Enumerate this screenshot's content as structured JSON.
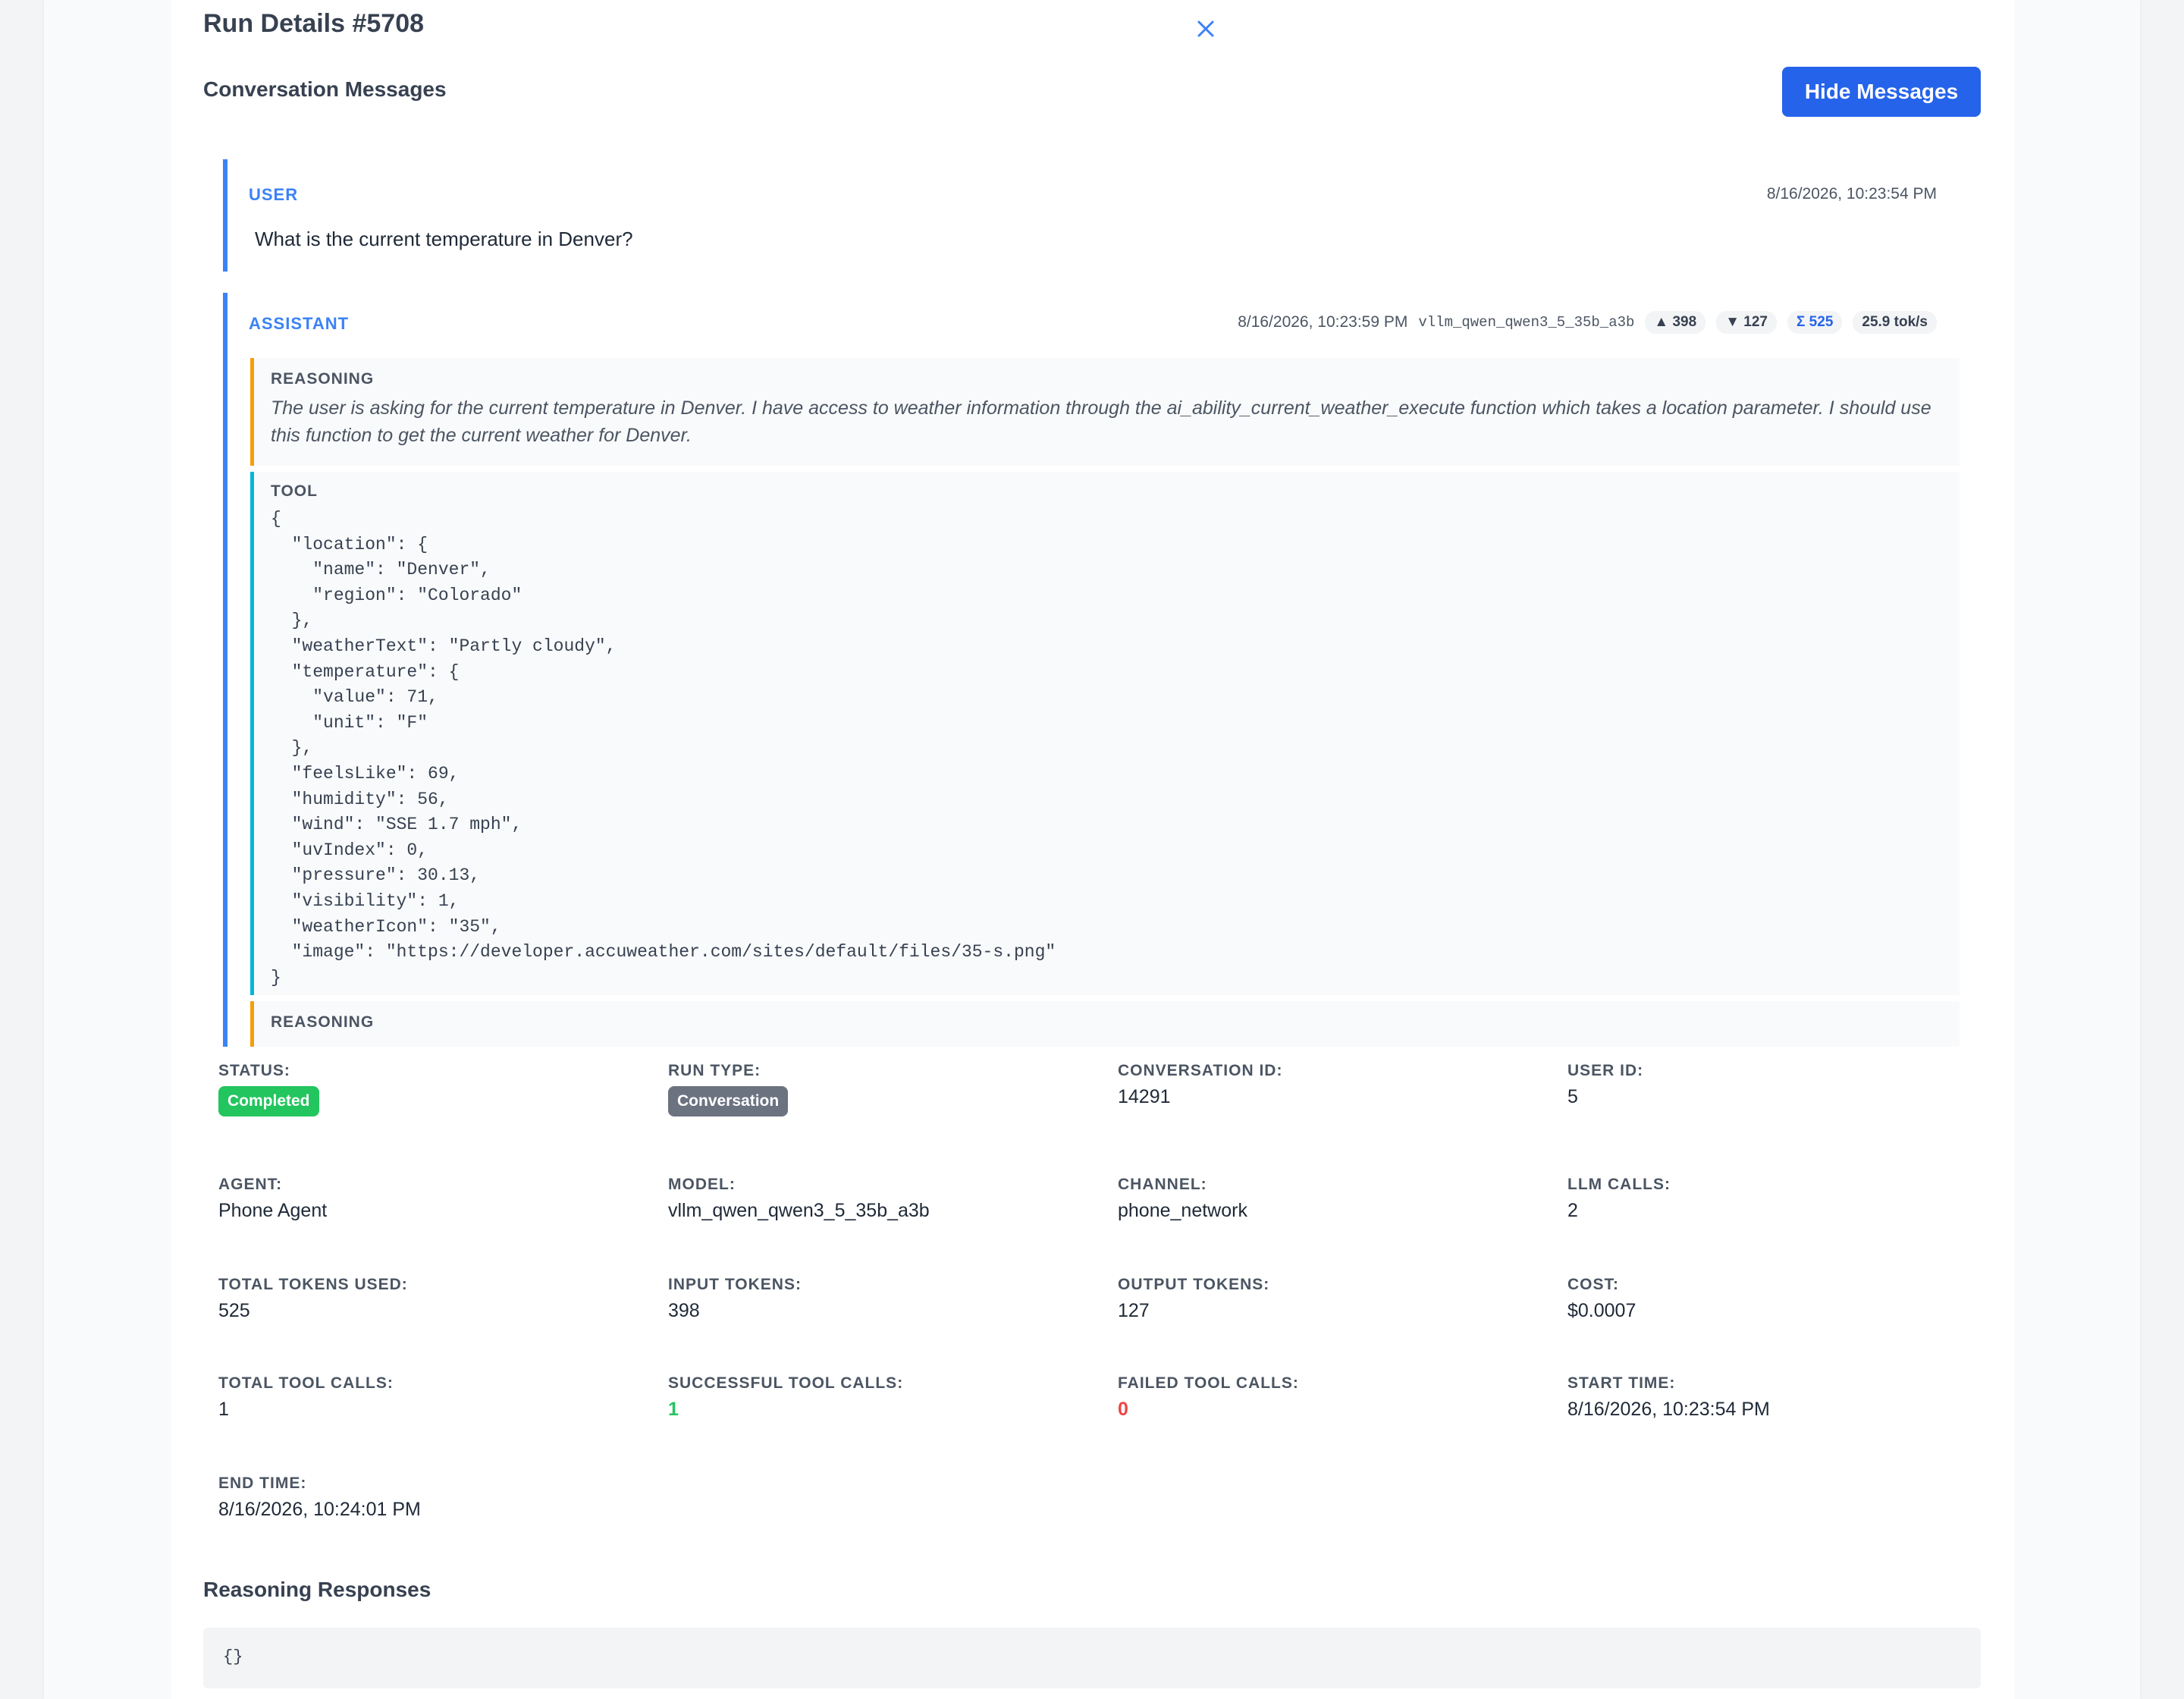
{
  "header": {
    "title": "Run Details #5708",
    "close_icon": "close-icon"
  },
  "messages_section": {
    "title": "Conversation Messages",
    "toggle_label": "Hide Messages",
    "user_message": {
      "role": "USER",
      "timestamp": "8/16/2026, 10:23:54 PM",
      "text": "What is the current temperature in Denver?"
    },
    "assistant_message": {
      "role": "ASSISTANT",
      "timestamp": "8/16/2026, 10:23:59 PM",
      "model": "vllm_qwen_qwen3_5_35b_a3b",
      "tokens_in": "▲ 398",
      "tokens_out": "▼ 127",
      "tokens_total": "Σ 525",
      "speed": "25.9 tok/s",
      "reasoning_label": "REASONING",
      "reasoning_text": "The user is asking for the current temperature in Denver. I have access to weather information through the ai_ability_current_weather_execute function which takes a location parameter. I should use this function to get the current weather for Denver.",
      "tool_label": "TOOL",
      "tool_output": "{\n  \"location\": {\n    \"name\": \"Denver\",\n    \"region\": \"Colorado\"\n  },\n  \"weatherText\": \"Partly cloudy\",\n  \"temperature\": {\n    \"value\": 71,\n    \"unit\": \"F\"\n  },\n  \"feelsLike\": 69,\n  \"humidity\": 56,\n  \"wind\": \"SSE 1.7 mph\",\n  \"uvIndex\": 0,\n  \"pressure\": 30.13,\n  \"visibility\": 1,\n  \"weatherIcon\": \"35\",\n  \"image\": \"https://developer.accuweather.com/sites/default/files/35-s.png\"\n}",
      "reasoning2_label": "REASONING"
    }
  },
  "details": {
    "status": {
      "label": "STATUS:",
      "value": "Completed"
    },
    "run_type": {
      "label": "RUN TYPE:",
      "value": "Conversation"
    },
    "conversation_id": {
      "label": "CONVERSATION ID:",
      "value": "14291"
    },
    "user_id": {
      "label": "USER ID:",
      "value": "5"
    },
    "agent": {
      "label": "AGENT:",
      "value": "Phone Agent"
    },
    "model": {
      "label": "MODEL:",
      "value": "vllm_qwen_qwen3_5_35b_a3b"
    },
    "channel": {
      "label": "CHANNEL:",
      "value": "phone_network"
    },
    "llm_calls": {
      "label": "LLM CALLS:",
      "value": "2"
    },
    "total_tokens": {
      "label": "TOTAL TOKENS USED:",
      "value": "525"
    },
    "input_tokens": {
      "label": "INPUT TOKENS:",
      "value": "398"
    },
    "output_tokens": {
      "label": "OUTPUT TOKENS:",
      "value": "127"
    },
    "cost": {
      "label": "COST:",
      "value": "$0.0007"
    },
    "total_tool_calls": {
      "label": "TOTAL TOOL CALLS:",
      "value": "1"
    },
    "successful_tool_calls": {
      "label": "SUCCESSFUL TOOL CALLS:",
      "value": "1"
    },
    "failed_tool_calls": {
      "label": "FAILED TOOL CALLS:",
      "value": "0"
    },
    "start_time": {
      "label": "START TIME:",
      "value": "8/16/2026, 10:23:54 PM"
    },
    "end_time": {
      "label": "END TIME:",
      "value": "8/16/2026, 10:24:01 PM"
    }
  },
  "reasoning_responses": {
    "title": "Reasoning Responses",
    "value": "{}"
  },
  "colors": {
    "primary": "#2563eb",
    "accent_blue": "#3b82f6",
    "reasoning_border": "#f59e0b",
    "tool_border": "#06b6d4",
    "success": "#22c55e",
    "danger": "#ef4444",
    "neutral_badge": "#6b7280"
  }
}
